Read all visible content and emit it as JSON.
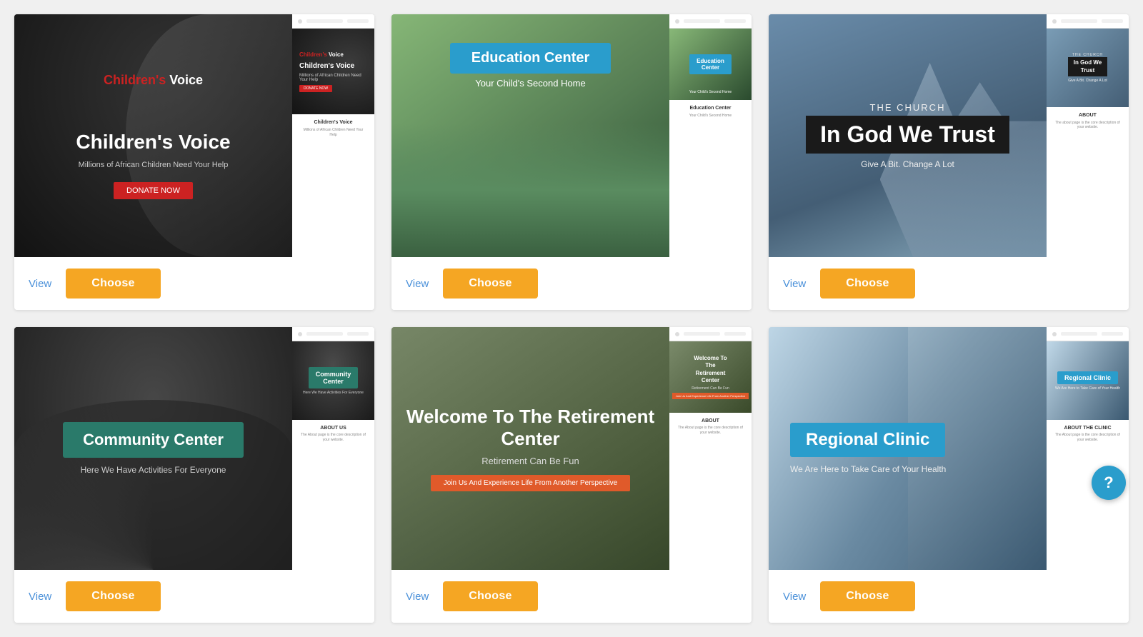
{
  "cards": [
    {
      "id": "childrens-voice",
      "title": "Children's Voice",
      "subtitle": "Millions of African Children Need Your Help",
      "badge_label": "Children's Voice",
      "badge_color": "#cc2222",
      "view_label": "View",
      "choose_label": "Choose",
      "mobile_section_title": "Children's Voice",
      "mobile_section_text": "Millions of African Children Need Your Help"
    },
    {
      "id": "education-center",
      "title": "Education Center",
      "subtitle": "Your Child's Second Home",
      "badge_label": "Education Center",
      "badge_color": "#2a9dcc",
      "view_label": "View",
      "choose_label": "Choose",
      "mobile_section_title": "Education Center",
      "mobile_section_text": "Your Child's Second Home"
    },
    {
      "id": "local-church",
      "title": "In God We Trust",
      "subtitle": "THE CHURCH",
      "tagline": "Give A Bit. Change A Lot",
      "badge_label": "In God We Trust",
      "badge_color": "#1a1a1a",
      "view_label": "View",
      "choose_label": "Choose",
      "mobile_section_title": "ABOUT",
      "mobile_section_text": "The about page is the core description of your website."
    },
    {
      "id": "community-center",
      "title": "Community Center",
      "subtitle": "Here We Have Activities For Everyone",
      "badge_label": "Community Center",
      "badge_color": "#2a7a6a",
      "view_label": "View",
      "choose_label": "Choose",
      "mobile_section_title": "ABOUT US",
      "mobile_section_text": "The About page is the core description of your website."
    },
    {
      "id": "retirement-centers",
      "title": "Welcome To The Retirement Center",
      "subtitle": "Retirement Can Be Fun",
      "cta_label": "Join Us And Experience Life From Another Perspective",
      "view_label": "View",
      "choose_label": "Choose",
      "mobile_section_title": "ABOUT",
      "mobile_section_text": "The About page is the core description of your website."
    },
    {
      "id": "regional-clinic",
      "title": "Regional Clinic",
      "subtitle": "We Are Here to Take Care of Your Health",
      "badge_label": "Regional Clinic",
      "badge_color": "#2a9dcc",
      "view_label": "View",
      "choose_label": "Choose",
      "mobile_section_title": "ABOUT THE CLINIC",
      "mobile_section_text": "The About page is the core description of your website."
    }
  ],
  "float_help_label": "?",
  "colors": {
    "choose_btn": "#f5a623",
    "view_link": "#4a90d9"
  }
}
